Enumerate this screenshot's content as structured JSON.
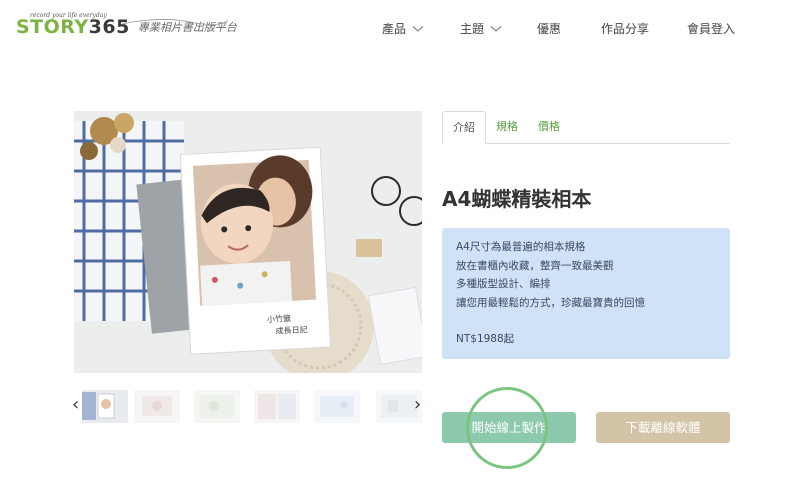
{
  "brand": {
    "tagline": "record your life everyday",
    "name_green": "STORY",
    "name_dark": "365",
    "subtitle": "專業相片書出版平台"
  },
  "nav": [
    {
      "label": "產品",
      "has_dropdown": true
    },
    {
      "label": "主題",
      "has_dropdown": true
    },
    {
      "label": "優惠",
      "has_dropdown": false
    },
    {
      "label": "作品分享",
      "has_dropdown": false
    },
    {
      "label": "會員登入",
      "has_dropdown": false
    }
  ],
  "gallery": {
    "main_image_caption": "小竹籤 成長日記",
    "prev_arrow": "‹",
    "next_arrow": "›",
    "thumbnail_count": 6,
    "selected_index": 0
  },
  "tabs": [
    {
      "label": "介紹",
      "active": true
    },
    {
      "label": "規格",
      "active": false
    },
    {
      "label": "價格",
      "active": false
    }
  ],
  "product": {
    "title": "A4蝴蝶精裝相本",
    "description": [
      "A4尺寸為最普遍的相本規格",
      "放在書櫃內收藏，整齊一致最美觀",
      "多種版型設計、編排",
      "讓您用最輕鬆的方式，珍藏最寶貴的回憶"
    ],
    "price": "NT$1988起"
  },
  "actions": {
    "start_online": "開始線上製作",
    "download_offline": "下載離線軟體"
  },
  "colors": {
    "brand_green": "#7cb342",
    "tab_link": "#5a9e3e",
    "desc_bg": "#cfe2f8",
    "start_button": "#8cc9ad",
    "download_button": "#d3c3a7",
    "highlight": "#7cc47f"
  },
  "icons": {
    "dropdown": "chevron-down-icon",
    "prev": "chevron-left-icon",
    "next": "chevron-right-icon"
  }
}
